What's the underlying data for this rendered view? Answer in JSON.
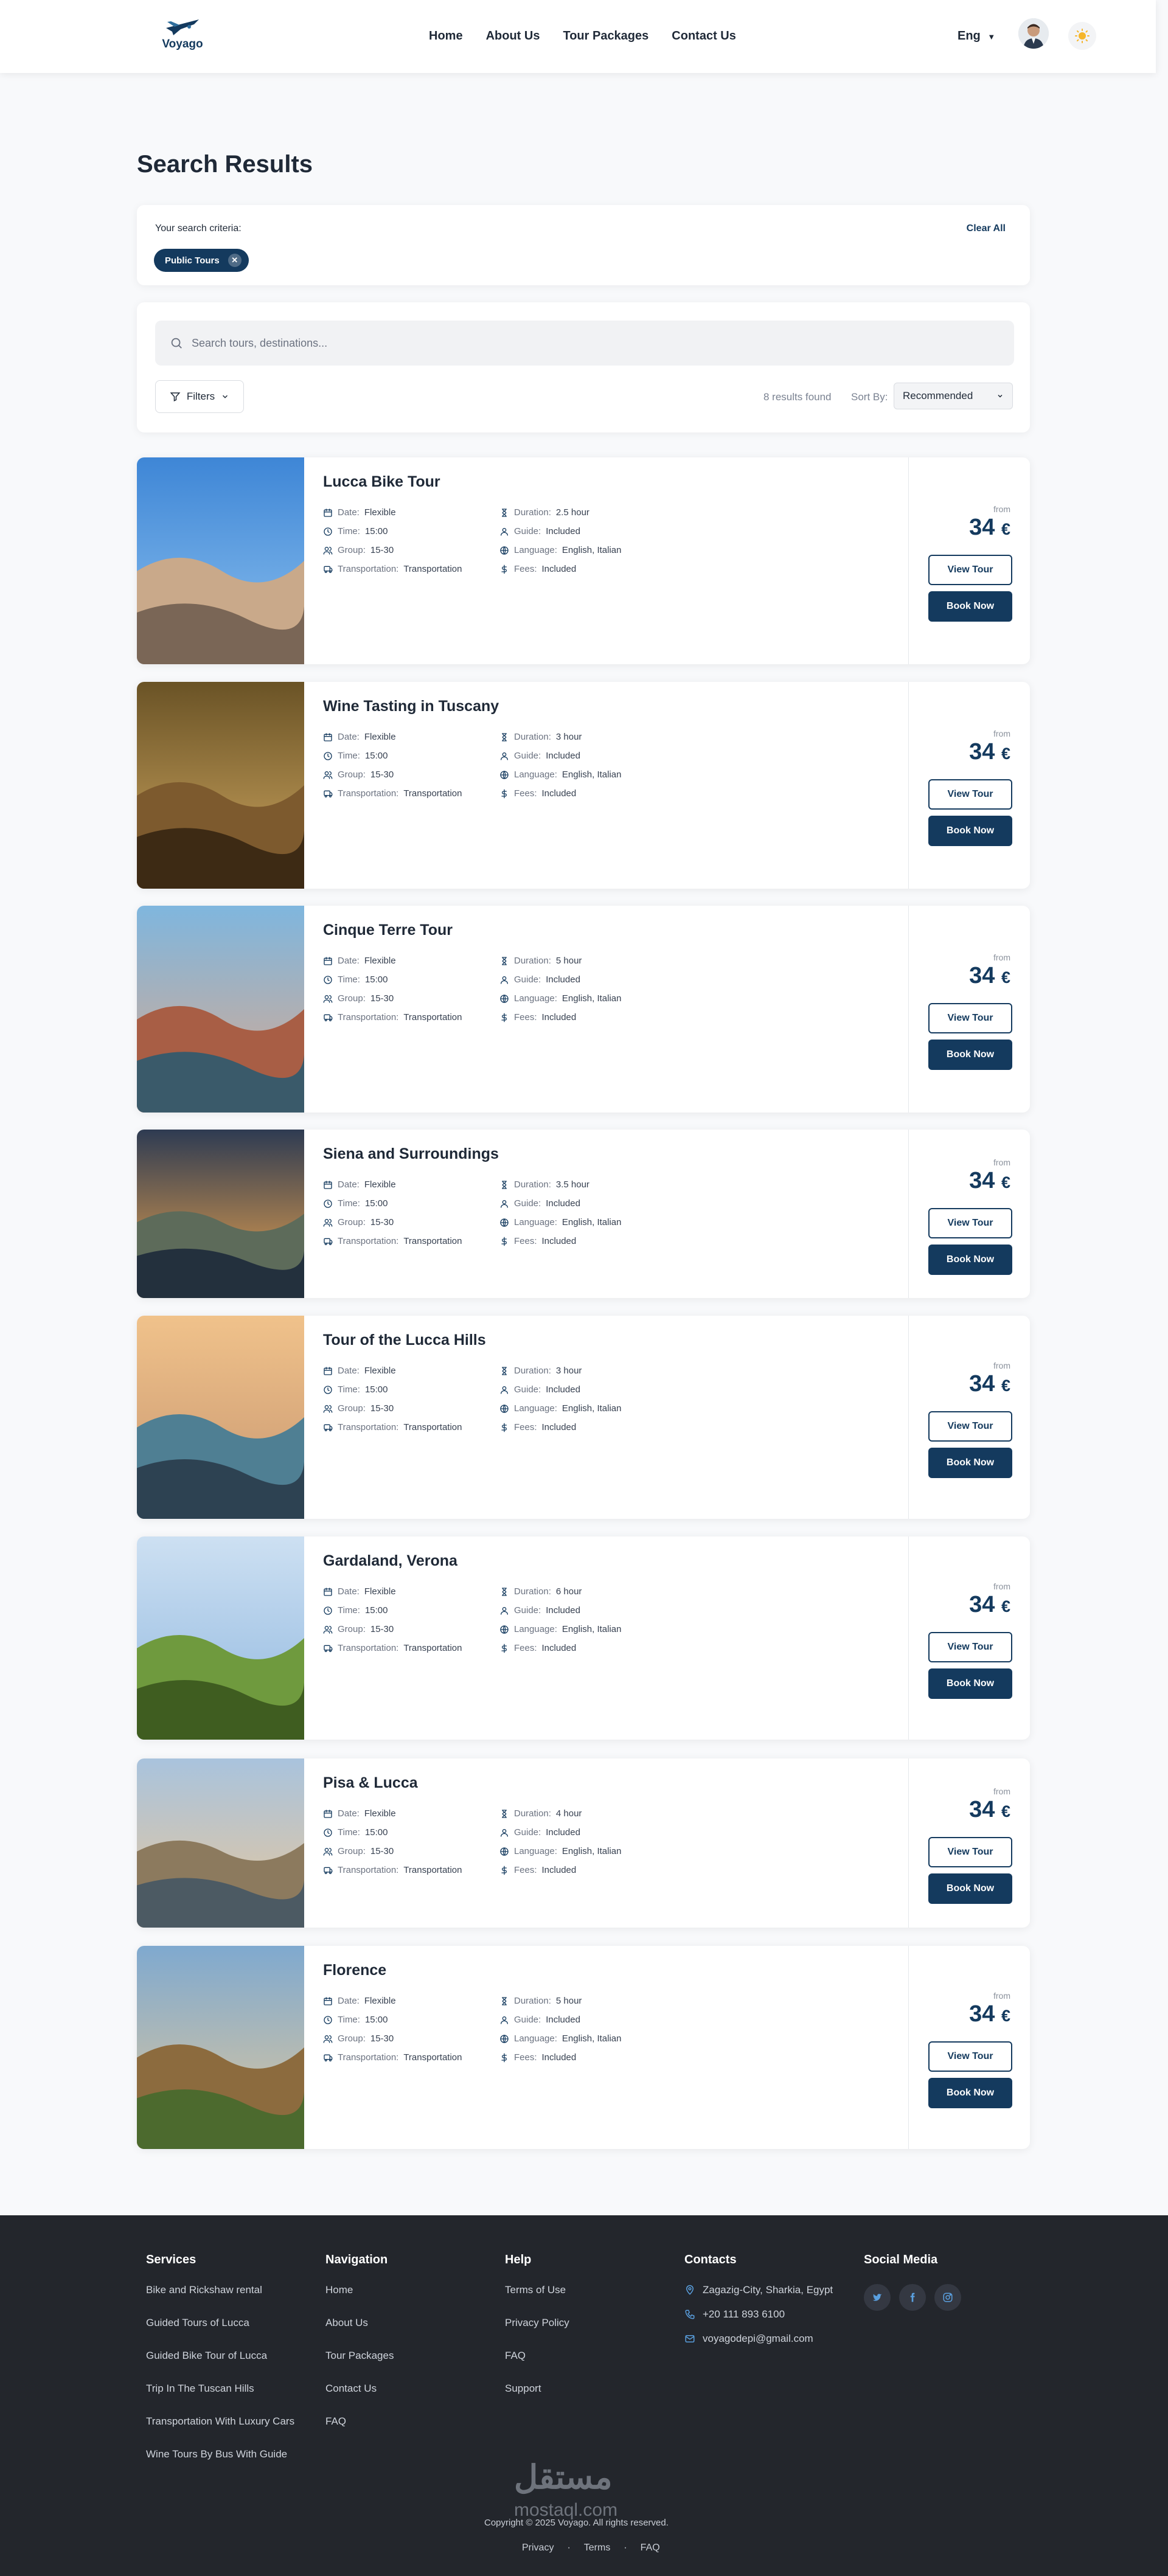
{
  "header": {
    "brand": "Voyago",
    "menu": [
      "Home",
      "About Us",
      "Tour Packages",
      "Contact Us"
    ],
    "language": "Eng",
    "colors": {
      "primary": "#143a5e",
      "theme_icon": "#f5b52a"
    }
  },
  "page": {
    "title": "Search Results"
  },
  "criteria": {
    "label": "Your search criteria:",
    "clear": "Clear All",
    "chip": "Public Tours"
  },
  "search": {
    "placeholder": "Search tours, destinations...",
    "filters_label": "Filters",
    "results_found": "8 results found",
    "sort_label": "Sort By:",
    "sort_value": "Recommended"
  },
  "labels": {
    "date": "Date:",
    "time": "Time:",
    "group": "Group:",
    "transportation": "Transportation:",
    "duration": "Duration:",
    "guide": "Guide:",
    "language": "Language:",
    "fees": "Fees:",
    "from": "from",
    "currency": "€",
    "view": "View Tour",
    "book": "Book Now"
  },
  "tours": [
    {
      "name": "Lucca Bike Tour",
      "date": "Flexible",
      "time": "15:00",
      "group": "15-30",
      "transportation": "Transportation",
      "duration": "2.5 hour",
      "guide": "Included",
      "language": "English, Italian",
      "fees": "Included",
      "price": "34"
    },
    {
      "name": "Wine Tasting in Tuscany",
      "date": "Flexible",
      "time": "15:00",
      "group": "15-30",
      "transportation": "Transportation",
      "duration": "3 hour",
      "guide": "Included",
      "language": "English, Italian",
      "fees": "Included",
      "price": "34"
    },
    {
      "name": "Cinque Terre Tour",
      "date": "Flexible",
      "time": "15:00",
      "group": "15-30",
      "transportation": "Transportation",
      "duration": "5 hour",
      "guide": "Included",
      "language": "English, Italian",
      "fees": "Included",
      "price": "34"
    },
    {
      "name": "Siena and Surroundings",
      "date": "Flexible",
      "time": "15:00",
      "group": "15-30",
      "transportation": "Transportation",
      "duration": "3.5 hour",
      "guide": "Included",
      "language": "English, Italian",
      "fees": "Included",
      "price": "34"
    },
    {
      "name": "Tour of the Lucca Hills",
      "date": "Flexible",
      "time": "15:00",
      "group": "15-30",
      "transportation": "Transportation",
      "duration": "3 hour",
      "guide": "Included",
      "language": "English, Italian",
      "fees": "Included",
      "price": "34"
    },
    {
      "name": "Gardaland, Verona",
      "date": "Flexible",
      "time": "15:00",
      "group": "15-30",
      "transportation": "Transportation",
      "duration": "6 hour",
      "guide": "Included",
      "language": "English, Italian",
      "fees": "Included",
      "price": "34"
    },
    {
      "name": "Pisa & Lucca",
      "date": "Flexible",
      "time": "15:00",
      "group": "15-30",
      "transportation": "Transportation",
      "duration": "4 hour",
      "guide": "Included",
      "language": "English, Italian",
      "fees": "Included",
      "price": "34"
    },
    {
      "name": "Florence",
      "date": "Flexible",
      "time": "15:00",
      "group": "15-30",
      "transportation": "Transportation",
      "duration": "5 hour",
      "guide": "Included",
      "language": "English, Italian",
      "fees": "Included",
      "price": "34"
    }
  ],
  "footer": {
    "services_title": "Services",
    "services": [
      "Bike and Rickshaw rental",
      "Guided Tours of Lucca",
      "Guided Bike Tour of Lucca",
      "Trip In The Tuscan Hills",
      "Transportation With Luxury Cars",
      "Wine Tours By Bus With Guide"
    ],
    "navigation_title": "Navigation",
    "navigation": [
      "Home",
      "About Us",
      "Tour Packages",
      "Contact Us",
      "FAQ"
    ],
    "help_title": "Help",
    "help": [
      "Terms of Use",
      "Privacy Policy",
      "FAQ",
      "Support"
    ],
    "contacts_title": "Contacts",
    "address": "Zagazig-City, Sharkia, Egypt",
    "phone": "+20 111 893 6100",
    "email": "voyagodepi@gmail.com",
    "social_title": "Social Media",
    "copyright": "Copyright © 2025 Voyago. All rights reserved.",
    "watermark": "مستقل",
    "watermark_url": "mostaql.com",
    "links": [
      "Privacy",
      "Terms",
      "FAQ"
    ]
  }
}
